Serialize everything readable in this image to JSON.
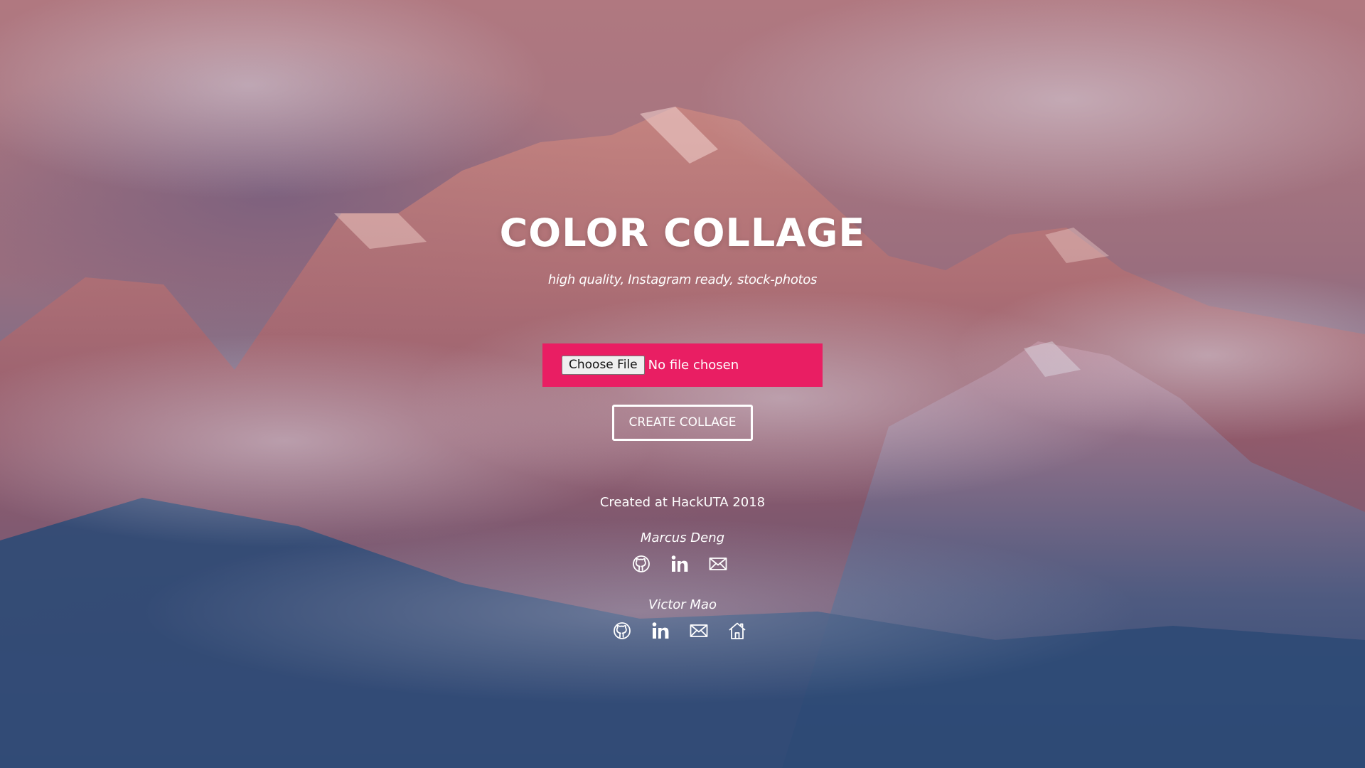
{
  "hero": {
    "title": "COLOR COLLAGE",
    "subtitle": "high quality, Instagram ready, stock-photos"
  },
  "upload": {
    "choose_label": "Choose File",
    "status": "No file chosen",
    "accent_color": "#e91e63"
  },
  "actions": {
    "create_label": "CREATE COLLAGE"
  },
  "footer": {
    "created_text": "Created at HackUTA 2018",
    "people": [
      {
        "name": "Marcus Deng",
        "icons": [
          "github-icon",
          "linkedin-icon",
          "mail-icon"
        ]
      },
      {
        "name": "Victor Mao",
        "icons": [
          "github-icon",
          "linkedin-icon",
          "mail-icon",
          "home-icon"
        ]
      }
    ]
  }
}
